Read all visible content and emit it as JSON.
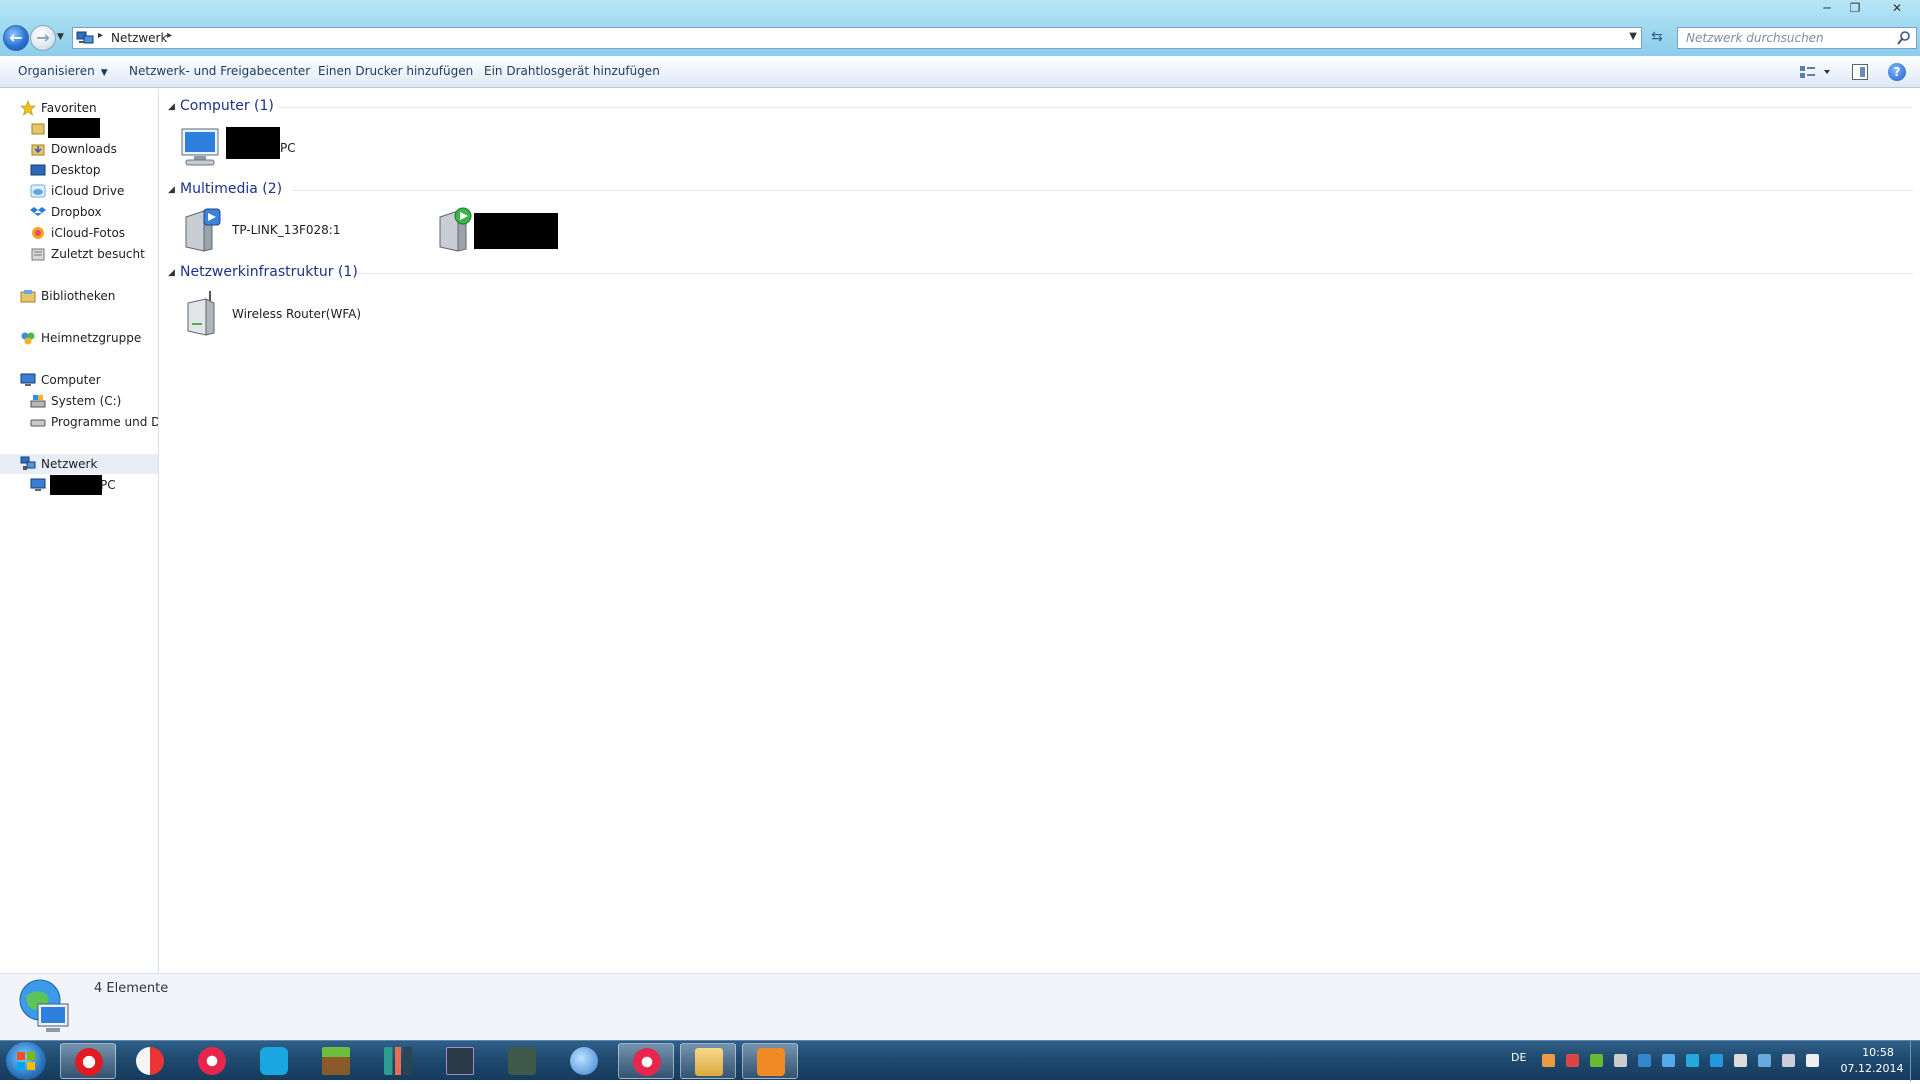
{
  "window": {
    "address": {
      "crumbs": [
        "Netzwerk"
      ]
    },
    "search": {
      "placeholder": "Netzwerk durchsuchen"
    }
  },
  "toolbar": {
    "organize": "Organisieren",
    "network_center": "Netzwerk- und Freigabecenter",
    "add_printer": "Einen Drucker hinzufügen",
    "add_wireless": "Ein Drahtlosgerät hinzufügen"
  },
  "navpane": {
    "favorites": "Favoriten",
    "favorites_items": [
      "Downloads",
      "Desktop",
      "iCloud Drive",
      "Dropbox",
      "iCloud-Fotos",
      "Zuletzt besucht"
    ],
    "libraries": "Bibliotheken",
    "homegroup": "Heimnetzgruppe",
    "computer": "Computer",
    "computer_items": [
      "System (C:)",
      "Programme und Dat"
    ],
    "network": "Netzwerk",
    "network_child_suffix": "PC"
  },
  "groups": [
    {
      "title": "Computer (1)",
      "items": [
        {
          "label_suffix": "PC"
        }
      ]
    },
    {
      "title": "Multimedia (2)",
      "items": [
        {
          "label": "TP-LINK_13F028:1"
        }
      ]
    },
    {
      "title": "Netzwerkinfrastruktur (1)",
      "items": [
        {
          "label": "Wireless Router(WFA)"
        }
      ]
    }
  ],
  "details": {
    "count": "4 Elemente"
  },
  "taskbar": {
    "language": "DE",
    "time": "10:58",
    "date": "07.12.2014"
  },
  "colors": {
    "group_title": "#1e3287",
    "taskbar": "#1f4a70",
    "titlebar": "#a4dcf2"
  }
}
